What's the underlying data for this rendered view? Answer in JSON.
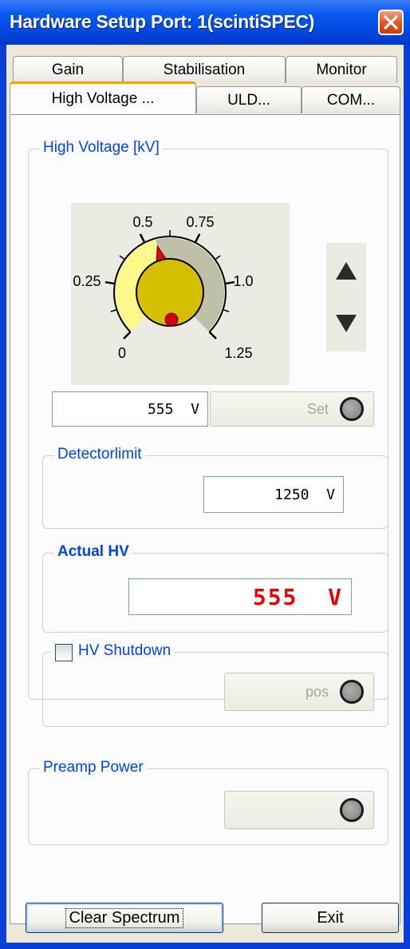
{
  "window": {
    "title": "Hardware Setup Port: 1(scintiSPEC)"
  },
  "tabs": {
    "row_back": [
      "Gain",
      "Stabilisation",
      "Monitor"
    ],
    "row_front": [
      "High Voltage ...",
      "ULD...",
      "COM..."
    ],
    "active": "High Voltage ..."
  },
  "high_voltage": {
    "group_label": "High Voltage [kV]",
    "dial": {
      "ticks": [
        "0",
        "0.25",
        "0.5",
        "0.75",
        "1.0",
        "1.25"
      ],
      "value_kv": 0.555
    },
    "up_icon": "up-arrow-icon",
    "down_icon": "down-arrow-icon",
    "setpoint_value": "555  V",
    "set_button_label": "Set"
  },
  "detector_limit": {
    "label": "Detectorlimit",
    "value": "1250  V"
  },
  "actual_hv": {
    "label": "Actual HV",
    "value": "555  V",
    "color": "#e00000"
  },
  "hv_shutdown": {
    "label": "HV Shutdown",
    "checked": false,
    "button_label": "pos"
  },
  "preamp_power": {
    "label": "Preamp Power"
  },
  "footer": {
    "clear_button": "Clear Spectrum",
    "exit_button": "Exit"
  },
  "colors": {
    "title_bar": "#0a5af0",
    "tab_highlight": "#f7a400",
    "group_label": "#0046d5",
    "dial_face": "#d4c000"
  }
}
